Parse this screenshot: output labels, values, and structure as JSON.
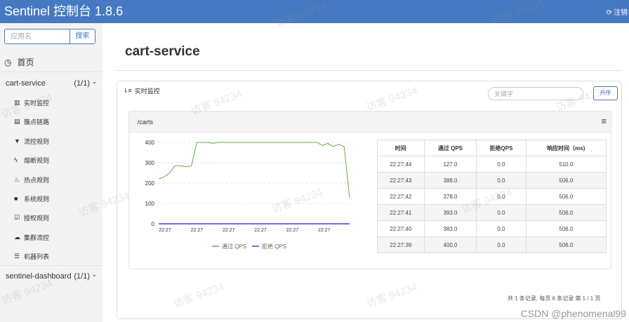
{
  "header": {
    "title": "Sentinel 控制台 1.8.6",
    "logout_label": "注销",
    "logout_icon": "logout-icon"
  },
  "sidebar": {
    "search_placeholder": "应用名",
    "search_button": "搜索",
    "home_label": "首页",
    "apps": [
      {
        "name": "cart-service",
        "count": "(1/1)",
        "menu": [
          {
            "label": "实时监控",
            "icon": "bar-chart-icon"
          },
          {
            "label": "簇点链路",
            "icon": "list-icon"
          },
          {
            "label": "流控规则",
            "icon": "filter-icon"
          },
          {
            "label": "熔断规则",
            "icon": "bolt-icon"
          },
          {
            "label": "热点规则",
            "icon": "fire-icon"
          },
          {
            "label": "系统规则",
            "icon": "lock-icon"
          },
          {
            "label": "授权规则",
            "icon": "check-icon"
          },
          {
            "label": "集群流控",
            "icon": "cloud-icon"
          },
          {
            "label": "机器列表",
            "icon": "list-icon"
          }
        ]
      },
      {
        "name": "sentinel-dashboard",
        "count": "(1/1)",
        "menu": []
      }
    ]
  },
  "main": {
    "page_title": "cart-service",
    "panel_title": "实时监控",
    "keyword_placeholder": "关键字",
    "sort_button": "升序",
    "resource": {
      "name": "/carts",
      "table": {
        "headers": [
          "时间",
          "通过 QPS",
          "拒绝QPS",
          "响应时间（ms)"
        ],
        "rows": [
          [
            "22:27:44",
            "127.0",
            "0.0",
            "510.0"
          ],
          [
            "22:27:43",
            "388.0",
            "0.0",
            "506.0"
          ],
          [
            "22:27:42",
            "378.0",
            "0.0",
            "506.0"
          ],
          [
            "22:27:41",
            "393.0",
            "0.0",
            "506.0"
          ],
          [
            "22:27:40",
            "383.0",
            "0.0",
            "506.0"
          ],
          [
            "22:27:39",
            "400.0",
            "0.0",
            "506.0"
          ]
        ]
      }
    },
    "pagination": "共 1 条记录, 每页 6 条记录 第 1 / 1 页"
  },
  "chart_data": {
    "type": "line",
    "x": [
      "22:27",
      "22:27",
      "22:27",
      "22:27",
      "22:27",
      "22:27"
    ],
    "ylim": [
      0,
      400
    ],
    "yticks": [
      0,
      100,
      200,
      300,
      400
    ],
    "series": [
      {
        "name": "通过 QPS",
        "color": "#6aa84f",
        "values": [
          220,
          230,
          250,
          285,
          285,
          280,
          285,
          400,
          400,
          400,
          395,
          400,
          400,
          400,
          400,
          400,
          400,
          400,
          400,
          400,
          400,
          400,
          400,
          400,
          400,
          400,
          400,
          400,
          400,
          400,
          385,
          395,
          380,
          390,
          380,
          127
        ]
      },
      {
        "name": "拒绝 QPS",
        "color": "#3c3cdc",
        "values": [
          0,
          0,
          0,
          0,
          0,
          0,
          0,
          0,
          0,
          0,
          0,
          0,
          0,
          0,
          0,
          0,
          0,
          0,
          0,
          0,
          0,
          0,
          0,
          0,
          0,
          0,
          0,
          0,
          0,
          0,
          0,
          0,
          0,
          0,
          0,
          0
        ]
      }
    ]
  },
  "watermark": "访客 94234",
  "credit": "CSDN @phenomenal99"
}
